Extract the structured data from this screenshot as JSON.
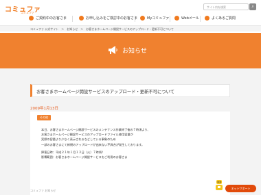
{
  "header": {
    "logo": "コミュファ",
    "logo_sub": "コミュファ",
    "search_placeholder": "サイト内を検索"
  },
  "nav": {
    "items": [
      {
        "label": "ご契約中のお客さま"
      },
      {
        "label": "お申し込みをご検討中のお客さま"
      },
      {
        "label": "Myコミュファ"
      },
      {
        "label": "Webメール"
      },
      {
        "label": "よくあるご質問"
      }
    ]
  },
  "breadcrumb": "コミュファ 公式サイト　＞　お知らせ　＞　お客さまホームページ開設サービスのアップロード・更新不可について",
  "banner": {
    "title": "お知らせ"
  },
  "article": {
    "title": "お客さまホームページ開設サービスのアップロード・更新不可について",
    "date": "2009年1月13日",
    "tag": "その他",
    "lines": [
      "本日、お客さまホームページ開設サービスのメンテナンス作業終了後の７時頃より、",
      "お客さまホームページ開設サービスのアップロードファイル使用容量が",
      "実際の容量より少なく表示されるなどしている事象のため",
      "一部のお客さまにて新規のアップロードが出来ない不具合が発生しております。",
      "障害日時：平成２１年１月１３日（火）７時頃？",
      "影響範囲：お客さまホームページ開設サービスをご利用のお客さま"
    ]
  },
  "support": {
    "label": "ネットサポート"
  },
  "footer": {
    "fragment": "コミュファ お知らせ"
  }
}
